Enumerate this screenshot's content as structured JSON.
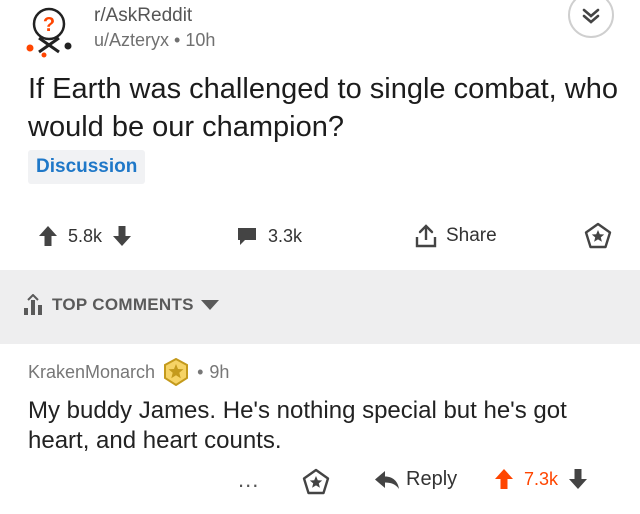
{
  "post": {
    "subreddit": "r/AskReddit",
    "author": "u/Azteryx",
    "separator": "•",
    "age": "10h",
    "title": "If Earth was challenged to single combat, who would be our champion?",
    "flair": "Discussion",
    "score": "5.8k",
    "comments_count": "3.3k",
    "share_label": "Share"
  },
  "comments_section": {
    "sort_label": "TOP COMMENTS"
  },
  "comment": {
    "author": "KrakenMonarch",
    "separator": "•",
    "age": "9h",
    "body": "My buddy James. He's nothing special but he's got heart, and heart counts.",
    "more_label": "...",
    "reply_label": "Reply",
    "score": "7.3k"
  },
  "colors": {
    "upvoted": "#ff4500",
    "flair_text": "#1f78c8",
    "band": "#eeeeef",
    "gold_award": "#f0b429"
  },
  "icons": [
    "subreddit-avatar-icon",
    "collapse-chevron-icon",
    "upvote-arrow-icon",
    "downvote-arrow-icon",
    "comment-bubble-icon",
    "share-icon",
    "star-icon",
    "sort-bars-icon",
    "dropdown-caret-icon",
    "gold-award-icon",
    "reply-arrow-icon"
  ]
}
